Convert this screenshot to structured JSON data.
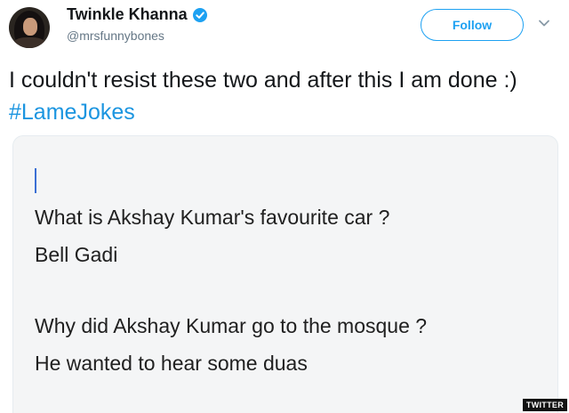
{
  "user": {
    "name": "Twinkle Khanna",
    "handle": "@mrsfunnybones",
    "verified_icon": "verified-badge-icon",
    "avatar_icon": "avatar-photo"
  },
  "follow_label": "Follow",
  "menu_icon": "chevron-down-icon",
  "tweet": {
    "text": "I couldn't resist these two and after this I am done :) ",
    "hashtag": "#LameJokes"
  },
  "card": {
    "joke1_question": "What is Akshay Kumar's favourite car ?",
    "joke1_answer": "Bell Gadi",
    "joke2_question": "Why did Akshay Kumar go to the mosque ?",
    "joke2_answer": "He wanted to hear some duas"
  },
  "watermark": "TWITTER",
  "colors": {
    "accent": "#1da1f2",
    "hashtag": "#1b95e0",
    "text": "#14171a",
    "muted": "#657786",
    "card_bg": "#f4f5f6"
  }
}
